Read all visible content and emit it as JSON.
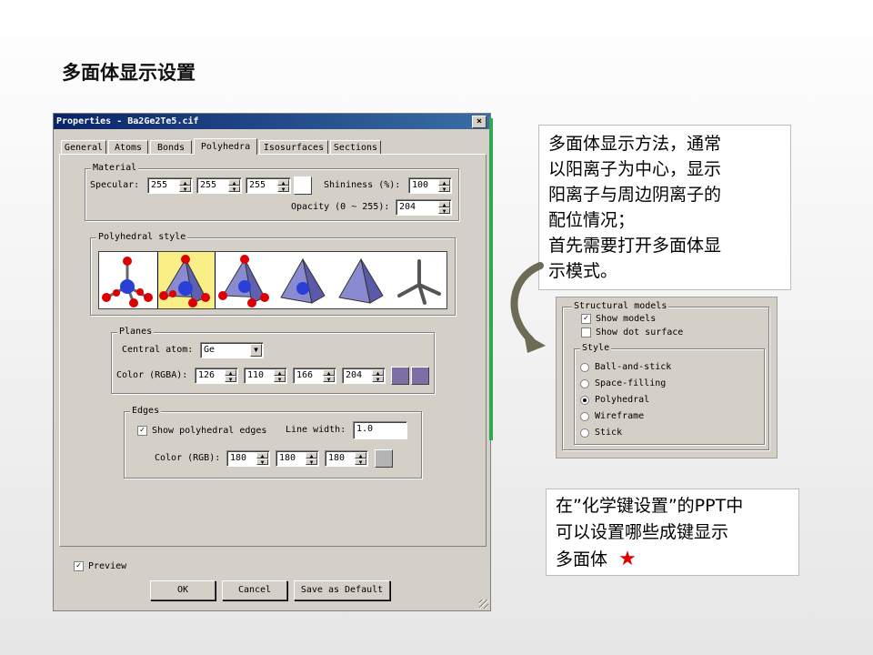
{
  "slide": {
    "title": "多面体显示设置",
    "callout_main": [
      "多面体显示方法，通常",
      "以阳离子为中心，显示",
      "阳离子与周边阴离子的",
      "配位情况；",
      "首先需要打开多面体显",
      "示模式。"
    ],
    "callout_note": [
      "在”化学键设置”的PPT中",
      "可以设置哪些成键显示",
      "多面体"
    ],
    "star": "★",
    "star_color": "#e00000"
  },
  "dialog": {
    "title": "Properties - Ba2Ge2Te5.cif",
    "close": "×",
    "tabs": [
      "General",
      "Atoms",
      "Bonds",
      "Polyhedra",
      "Isosurfaces",
      "Sections"
    ],
    "active_tab": "Polyhedra",
    "material": {
      "legend": "Material",
      "specular_label": "Specular:",
      "specular": [
        "255",
        "255",
        "255"
      ],
      "shininess_label": "Shininess (%):",
      "shininess": "100",
      "opacity_label": "Opacity (0 ~ 255):",
      "opacity": "204"
    },
    "polyhedral_style": {
      "legend": "Polyhedral style",
      "selected_index": 1
    },
    "planes": {
      "legend": "Planes",
      "central_atom_label": "Central atom:",
      "central_atom": "Ge",
      "color_label": "Color (RGBA):",
      "color": [
        "126",
        "110",
        "166",
        "204"
      ],
      "swatch_color": "#7e6ea6"
    },
    "edges": {
      "legend": "Edges",
      "show_edges_label": "Show polyhedral edges",
      "show_edges_checked": true,
      "line_width_label": "Line width:",
      "line_width": "1.0",
      "color_label": "Color (RGB):",
      "color": [
        "180",
        "180",
        "180"
      ],
      "swatch_color": "#b4b4b4"
    },
    "preview_label": "Preview",
    "preview_checked": true,
    "buttons": {
      "ok": "OK",
      "cancel": "Cancel",
      "save_default": "Save as Default"
    }
  },
  "structural_models": {
    "legend": "Structural models",
    "show_models": "Show models",
    "show_models_checked": true,
    "show_dot_surface": "Show dot surface",
    "show_dot_surface_checked": false,
    "style_legend": "Style",
    "styles": [
      "Ball-and-stick",
      "Space-filling",
      "Polyhedral",
      "Wireframe",
      "Stick"
    ],
    "selected_style": "Polyhedral"
  }
}
